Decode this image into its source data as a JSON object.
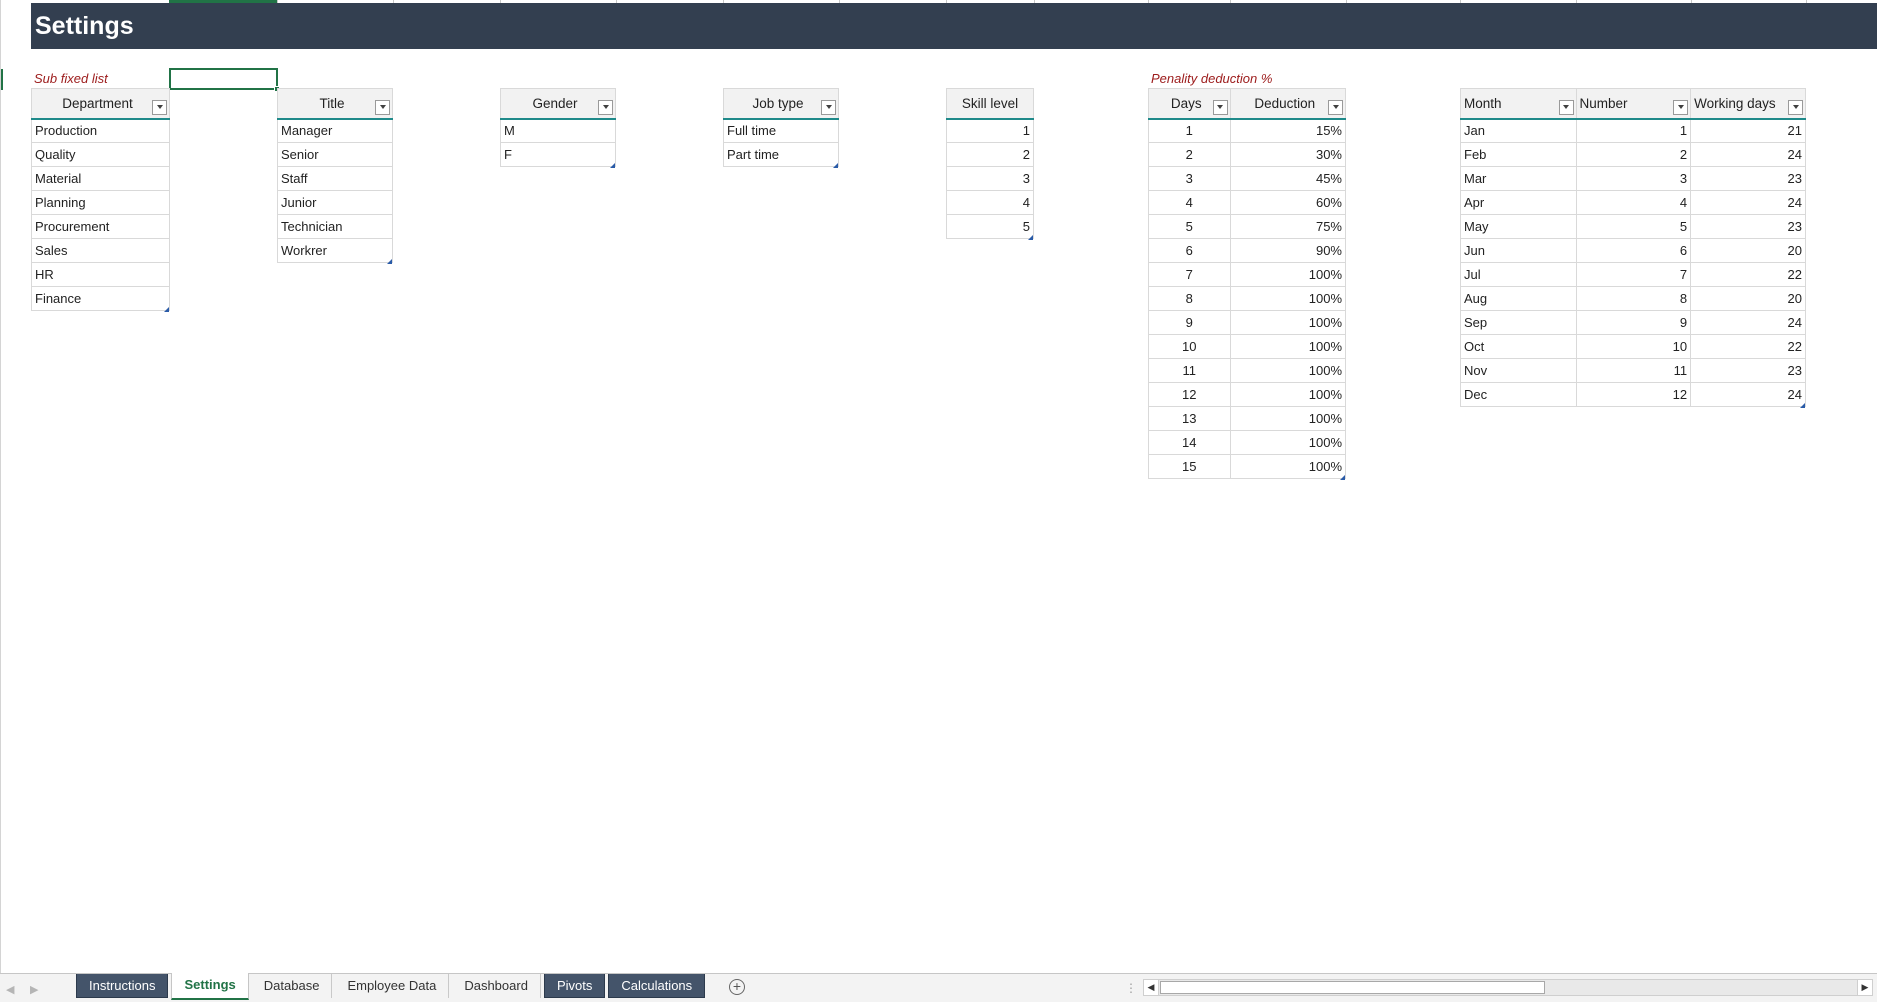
{
  "sheet": {
    "title": "Settings",
    "sub_fixed_note": "Sub fixed list",
    "penalty_note": "Penality deduction %"
  },
  "tables": {
    "department": {
      "header": "Department",
      "rows": [
        "Production",
        "Quality",
        "Material",
        "Planning",
        "Procurement",
        "Sales",
        "HR",
        "Finance"
      ]
    },
    "title": {
      "header": "Title",
      "rows": [
        "Manager",
        "Senior",
        "Staff",
        "Junior",
        "Technician",
        "Workrer"
      ]
    },
    "gender": {
      "header": "Gender",
      "rows": [
        "M",
        "F"
      ]
    },
    "job_type": {
      "header": "Job type",
      "rows": [
        "Full time",
        "Part time"
      ]
    },
    "skill_level": {
      "header": "Skill level",
      "rows": [
        "1",
        "2",
        "3",
        "4",
        "5"
      ]
    },
    "penalty": {
      "headers": [
        "Days",
        "Deduction"
      ],
      "rows": [
        [
          "1",
          "15%"
        ],
        [
          "2",
          "30%"
        ],
        [
          "3",
          "45%"
        ],
        [
          "4",
          "60%"
        ],
        [
          "5",
          "75%"
        ],
        [
          "6",
          "90%"
        ],
        [
          "7",
          "100%"
        ],
        [
          "8",
          "100%"
        ],
        [
          "9",
          "100%"
        ],
        [
          "10",
          "100%"
        ],
        [
          "11",
          "100%"
        ],
        [
          "12",
          "100%"
        ],
        [
          "13",
          "100%"
        ],
        [
          "14",
          "100%"
        ],
        [
          "15",
          "100%"
        ]
      ]
    },
    "months": {
      "headers": [
        "Month",
        "Number",
        "Working days"
      ],
      "rows": [
        [
          "Jan",
          "1",
          "21"
        ],
        [
          "Feb",
          "2",
          "24"
        ],
        [
          "Mar",
          "3",
          "23"
        ],
        [
          "Apr",
          "4",
          "24"
        ],
        [
          "May",
          "5",
          "23"
        ],
        [
          "Jun",
          "6",
          "20"
        ],
        [
          "Jul",
          "7",
          "22"
        ],
        [
          "Aug",
          "8",
          "20"
        ],
        [
          "Sep",
          "9",
          "24"
        ],
        [
          "Oct",
          "10",
          "22"
        ],
        [
          "Nov",
          "11",
          "23"
        ],
        [
          "Dec",
          "12",
          "24"
        ]
      ]
    }
  },
  "tabs": [
    {
      "label": "Instructions",
      "style": "dark"
    },
    {
      "label": "Settings",
      "style": "active"
    },
    {
      "label": "Database",
      "style": "plain"
    },
    {
      "label": "Employee Data",
      "style": "plain"
    },
    {
      "label": "Dashboard",
      "style": "plain"
    },
    {
      "label": "Pivots",
      "style": "dark"
    },
    {
      "label": "Calculations",
      "style": "dark"
    }
  ],
  "icons": {
    "dropdown": "chevron-down-icon",
    "add_sheet": "plus-circle-icon"
  },
  "colors": {
    "title_bar": "#333f50",
    "note_text": "#9c1b1b",
    "accent": "#217346",
    "table_header_line": "#1f8a8a",
    "dark_tab": "#44546a"
  }
}
